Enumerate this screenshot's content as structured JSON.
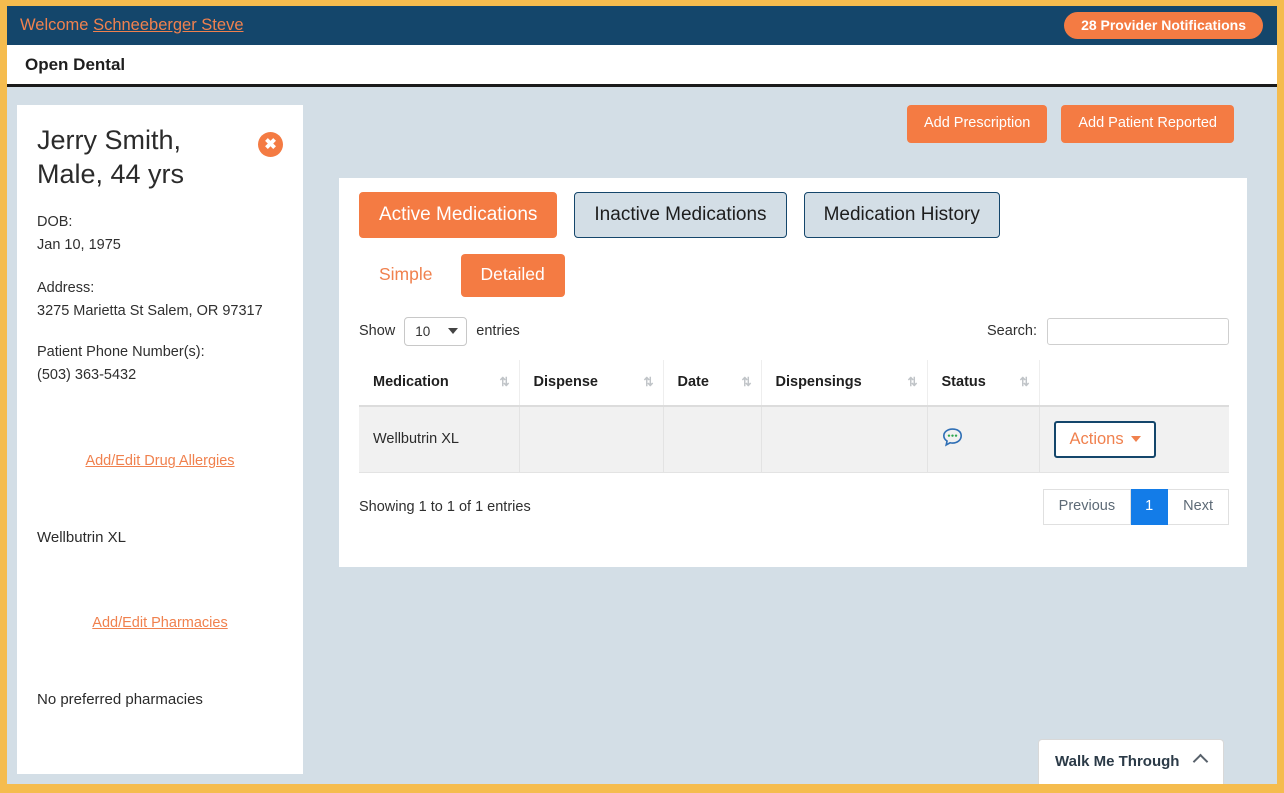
{
  "topbar": {
    "welcome_prefix": "Welcome ",
    "user_name": "Schneeberger Steve",
    "notifications_badge": "28 Provider Notifications"
  },
  "appbar": {
    "title": "Open Dental"
  },
  "patient": {
    "name": "Jerry Smith, Male, 44 yrs",
    "close_label": "✖",
    "dob_label": "DOB:",
    "dob_value": "Jan 10, 1975",
    "address_label": "Address:",
    "address_value": "3275 Marietta St Salem, OR 97317",
    "phone_label": "Patient Phone Number(s):",
    "phone_value": "(503) 363-5432",
    "allergies_link": "Add/Edit Drug Allergies",
    "allergy_item": "Wellbutrin XL",
    "pharmacies_link": "Add/Edit Pharmacies",
    "pharmacy_status": "No preferred pharmacies"
  },
  "top_actions": {
    "add_prescription": "Add Prescription",
    "add_patient_reported": "Add Patient Reported"
  },
  "tabs": [
    {
      "label": "Active Medications",
      "active": true
    },
    {
      "label": "Inactive Medications",
      "active": false
    },
    {
      "label": "Medication History",
      "active": false
    }
  ],
  "subtabs": [
    {
      "label": "Simple",
      "active": false
    },
    {
      "label": "Detailed",
      "active": true
    }
  ],
  "controls": {
    "show_label": "Show",
    "entries_label": "entries",
    "page_length": "10",
    "search_label": "Search:",
    "search_value": "",
    "search_placeholder": ""
  },
  "table": {
    "columns": [
      "Medication",
      "Dispense",
      "Date",
      "Dispensings",
      "Status",
      ""
    ],
    "sort_icon": "⇅",
    "rows": [
      {
        "medication": "Wellbutrin XL",
        "dispense": "",
        "date": "",
        "dispensings": "",
        "status_icon": "comment-bubble-icon",
        "actions_label": "Actions"
      }
    ]
  },
  "footer": {
    "showing": "Showing 1 to 1 of 1 entries",
    "previous": "Previous",
    "page_current": "1",
    "next": "Next"
  },
  "walk_me_through": {
    "label": "Walk Me Through"
  },
  "colors": {
    "navy": "#14466b",
    "orange": "#f47b43",
    "orange_text": "#f0814e",
    "amber_frame": "#f5bc4e",
    "page_bg": "#d3dee6",
    "pager_active": "#137ce8"
  }
}
